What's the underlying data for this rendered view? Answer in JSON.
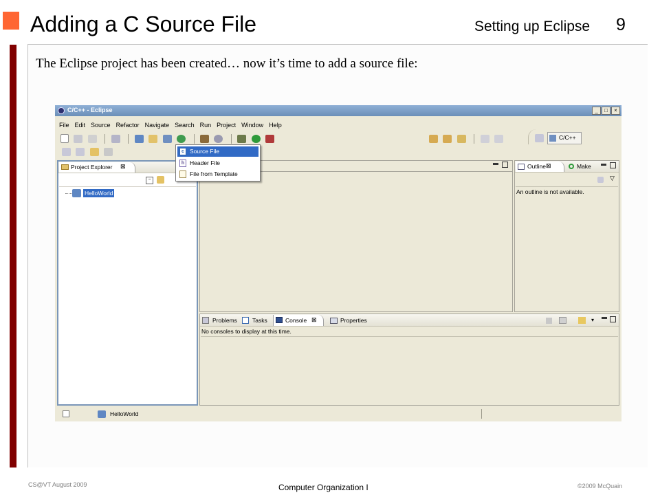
{
  "slide": {
    "title": "Adding a C Source File",
    "section": "Setting up Eclipse",
    "page_number": "9",
    "body_text": "The Eclipse project has been created… now it’s time to add a source file:",
    "footer_left": "CS@VT August 2009",
    "footer_center": "Computer Organization I",
    "footer_right": "©2009  McQuain",
    "colors": {
      "accent_orange": "#ff6633",
      "left_bar": "#800000"
    }
  },
  "eclipse": {
    "window_title": "C/C++ - Eclipse",
    "menu": [
      "File",
      "Edit",
      "Source",
      "Refactor",
      "Navigate",
      "Search",
      "Run",
      "Project",
      "Window",
      "Help"
    ],
    "perspective_label": "C/C++",
    "dropdown_items": [
      "Source File",
      "Header File",
      "File from Template"
    ],
    "project_explorer_tab": "Project Explorer",
    "project_name": "HelloWorld",
    "outline_tab": "Outline",
    "make_tab": "Make",
    "outline_message": "An outline is not available.",
    "bottom_tabs": [
      "Problems",
      "Tasks",
      "Console",
      "Properties"
    ],
    "console_message": "No consoles to display at this time.",
    "status_project": "HelloWorld",
    "colors": {
      "title_bar": "#6b8fb8",
      "selection": "#316ac5",
      "chrome": "#ece9d8",
      "panel_border": "#7a96b8"
    }
  }
}
